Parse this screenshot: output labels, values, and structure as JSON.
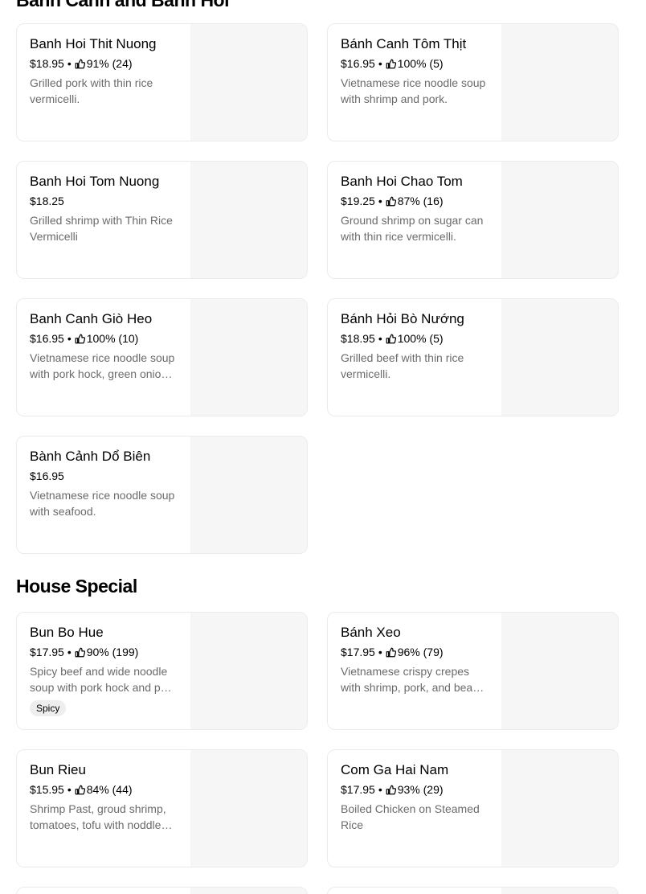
{
  "sections": [
    {
      "title": "Banh Canh and Banh Hoi",
      "items": [
        {
          "name": "Banh Hoi Thit Nuong",
          "price": "$18.95",
          "rating": "91% (24)",
          "desc": "Grilled pork with thin rice vermicelli."
        },
        {
          "name": "Bánh Canh Tôm Thịt",
          "price": "$16.95",
          "rating": "100% (5)",
          "desc": "Vietnamese rice noodle soup with shrimp and pork."
        },
        {
          "name": "Banh Hoi Tom Nuong",
          "price": "$18.25",
          "rating": "",
          "desc": "Grilled shrimp with Thin Rice Vermicelli"
        },
        {
          "name": "Banh Hoi Chao Tom",
          "price": "$19.25",
          "rating": "87% (16)",
          "desc": "Ground shrimp on sugar can with thin rice vermicelli."
        },
        {
          "name": "Banh Canh Giò Heo",
          "price": "$16.95",
          "rating": "100% (10)",
          "desc": "Vietnamese rice noodle soup with pork hock, green onion and cilantro."
        },
        {
          "name": "Bánh Hỏi Bò Nướng",
          "price": "$18.95",
          "rating": "100% (5)",
          "desc": "Grilled beef with thin rice vermicelli."
        },
        {
          "name": "Bành Cảnh Dổ Biên",
          "price": "$16.95",
          "rating": "",
          "desc": "Vietnamese rice noodle soup with seafood."
        }
      ]
    },
    {
      "title": "House Special",
      "items": [
        {
          "name": "Bun Bo Hue",
          "price": "$17.95",
          "rating": "90% (199)",
          "desc": "Spicy beef and wide noodle soup with pork hock and pork blood.",
          "badge": "Spicy"
        },
        {
          "name": "Bánh Xeo",
          "price": "$17.95",
          "rating": "96% (79)",
          "desc": "Vietnamese crispy crepes with shrimp, pork, and bean sprouts."
        },
        {
          "name": "Bun Rieu",
          "price": "$15.95",
          "rating": "84% (44)",
          "desc": "Shrimp Past, groud shrimp, tomatoes, tofu with noddle soup."
        },
        {
          "name": "Com Ga Hai Nam",
          "price": "$17.95",
          "rating": "93% (29)",
          "desc": "Boiled Chicken on Steamed Rice"
        }
      ]
    }
  ],
  "icons": {
    "rating": "thumbs-up-icon"
  }
}
